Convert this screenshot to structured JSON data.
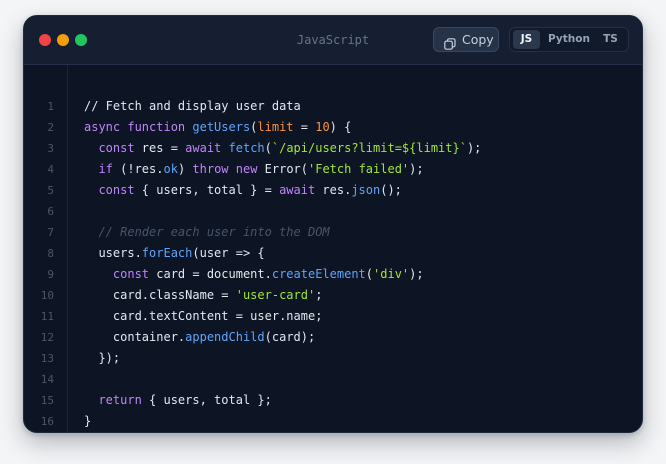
{
  "window": {
    "title": "JavaScript",
    "controls": [
      "close",
      "minimize",
      "maximize"
    ]
  },
  "toolbar": {
    "copy_label": "Copy",
    "copy_icon": "copy-icon",
    "languages": [
      {
        "label": "JS",
        "active": true
      },
      {
        "label": "Python",
        "active": false
      },
      {
        "label": "TS",
        "active": false
      }
    ]
  },
  "colors": {
    "background": "#0d1424",
    "keyword": "#c084fc",
    "function": "#60a5fa",
    "string": "#a3e635",
    "number": "#fb923c",
    "comment": "#475569",
    "text": "#e2e8f0"
  },
  "code": {
    "lines": [
      [
        [
          "plain",
          "// Fetch and display user data"
        ]
      ],
      [
        [
          "keyword",
          "async function "
        ],
        [
          "function",
          "getUsers"
        ],
        [
          "plain",
          "("
        ],
        [
          "param",
          "limit"
        ],
        [
          "plain",
          " = "
        ],
        [
          "number",
          "10"
        ],
        [
          "plain",
          ") {"
        ]
      ],
      [
        [
          "plain",
          "  "
        ],
        [
          "keyword",
          "const"
        ],
        [
          "plain",
          " res = "
        ],
        [
          "keyword",
          "await"
        ],
        [
          "plain",
          " "
        ],
        [
          "function",
          "fetch"
        ],
        [
          "plain",
          "("
        ],
        [
          "string",
          "`/api/users?limit=${limit}`"
        ],
        [
          "plain",
          ");"
        ]
      ],
      [
        [
          "plain",
          "  "
        ],
        [
          "keyword",
          "if"
        ],
        [
          "plain",
          " (!res."
        ],
        [
          "function",
          "ok"
        ],
        [
          "plain",
          ") "
        ],
        [
          "keyword",
          "throw new"
        ],
        [
          "plain",
          " Error("
        ],
        [
          "string",
          "'Fetch failed'"
        ],
        [
          "plain",
          ");"
        ]
      ],
      [
        [
          "plain",
          "  "
        ],
        [
          "keyword",
          "const"
        ],
        [
          "plain",
          " { users, total } = "
        ],
        [
          "keyword",
          "await"
        ],
        [
          "plain",
          " res."
        ],
        [
          "function",
          "json"
        ],
        [
          "plain",
          "();"
        ]
      ],
      [],
      [
        [
          "plain",
          "  "
        ],
        [
          "comment",
          "// Render each user into the DOM"
        ]
      ],
      [
        [
          "plain",
          "  users."
        ],
        [
          "function",
          "forEach"
        ],
        [
          "plain",
          "(user => {"
        ]
      ],
      [
        [
          "plain",
          "    "
        ],
        [
          "keyword",
          "const"
        ],
        [
          "plain",
          " card = document."
        ],
        [
          "function",
          "createElement"
        ],
        [
          "plain",
          "("
        ],
        [
          "string",
          "'div'"
        ],
        [
          "plain",
          ");"
        ]
      ],
      [
        [
          "plain",
          "    card.className = "
        ],
        [
          "string",
          "'user-card'"
        ],
        [
          "plain",
          ";"
        ]
      ],
      [
        [
          "plain",
          "    card.textContent = user.name;"
        ]
      ],
      [
        [
          "plain",
          "    container."
        ],
        [
          "function",
          "appendChild"
        ],
        [
          "plain",
          "(card);"
        ]
      ],
      [
        [
          "plain",
          "  });"
        ]
      ],
      [],
      [
        [
          "plain",
          "  "
        ],
        [
          "keyword",
          "return"
        ],
        [
          "plain",
          " { users, total };"
        ]
      ],
      [
        [
          "plain",
          "}"
        ]
      ]
    ],
    "line_numbers": [
      "1",
      "2",
      "3",
      "4",
      "5",
      "6",
      "7",
      "8",
      "9",
      "10",
      "11",
      "12",
      "13",
      "14",
      "15",
      "16"
    ]
  }
}
